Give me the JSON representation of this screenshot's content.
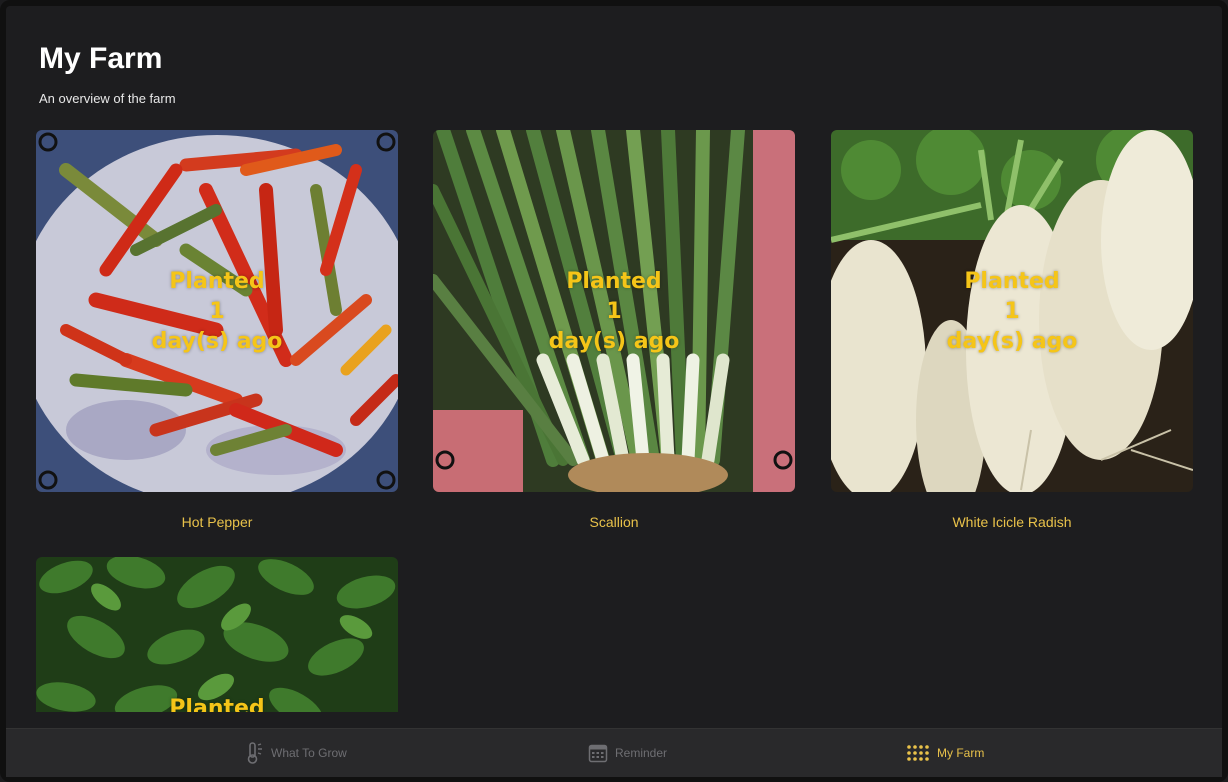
{
  "header": {
    "title": "My Farm",
    "subtitle": "An overview of the farm"
  },
  "crops": [
    {
      "name": "Hot Pepper",
      "status_line1": "Planted",
      "status_line2": "1",
      "status_line3": "day(s) ago",
      "image": "hot-pepper-photo"
    },
    {
      "name": "Scallion",
      "status_line1": "Planted",
      "status_line2": "1",
      "status_line3": "day(s) ago",
      "image": "scallion-photo"
    },
    {
      "name": "White Icicle Radish",
      "status_line1": "Planted",
      "status_line2": "1",
      "status_line3": "day(s) ago",
      "image": "white-icicle-radish-photo"
    },
    {
      "status_line1": "Planted",
      "image": "basil-leaves-photo"
    }
  ],
  "tabbar": {
    "tabs": [
      {
        "label": "What To Grow",
        "icon": "thermometer-sun-icon",
        "active": false
      },
      {
        "label": "Reminder",
        "icon": "calendar-icon",
        "active": false
      },
      {
        "label": "My Farm",
        "icon": "grid-dots-icon",
        "active": true
      }
    ]
  },
  "colors": {
    "background": "#1d1d1f",
    "accent": "#e9c24a",
    "overlay_text": "#f5c518",
    "tab_inactive": "#6e6e72"
  }
}
